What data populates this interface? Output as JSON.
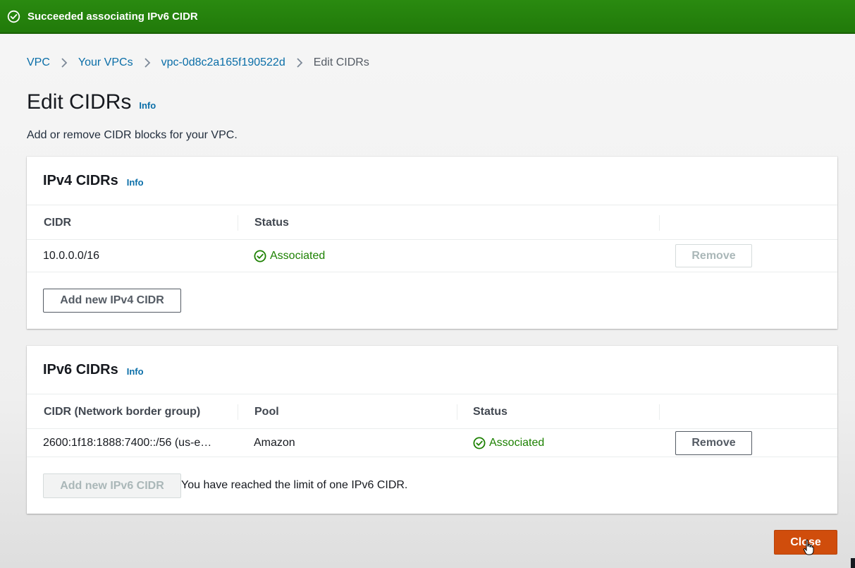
{
  "flash": {
    "message": "Succeeded associating IPv6 CIDR",
    "icon": "check-circle-icon",
    "color": "#217a0a"
  },
  "breadcrumb": {
    "items": [
      "VPC",
      "Your VPCs",
      "vpc-0d8c2a165f190522d"
    ],
    "current": "Edit CIDRs"
  },
  "page": {
    "title": "Edit CIDRs",
    "info": "Info",
    "description": "Add or remove CIDR blocks for your VPC."
  },
  "ipv4": {
    "title": "IPv4 CIDRs",
    "info": "Info",
    "columns": [
      "CIDR",
      "Status"
    ],
    "rows": [
      {
        "cidr": "10.0.0.0/16",
        "status": "Associated",
        "remove_label": "Remove",
        "remove_enabled": false
      }
    ],
    "add_button": "Add new IPv4 CIDR"
  },
  "ipv6": {
    "title": "IPv6 CIDRs",
    "info": "Info",
    "columns": [
      "CIDR (Network border group)",
      "Pool",
      "Status"
    ],
    "rows": [
      {
        "cidr": "2600:1f18:1888:7400::/56 (us-e…",
        "pool": "Amazon",
        "status": "Associated",
        "remove_label": "Remove",
        "remove_enabled": true
      }
    ],
    "add_button": "Add new IPv6 CIDR",
    "limit_message": "You have reached the limit of one IPv6 CIDR."
  },
  "footer": {
    "close_button": "Close",
    "accent_color": "#d04d0c"
  },
  "colors": {
    "link": "#0a6ea8",
    "success": "#1d8102"
  }
}
